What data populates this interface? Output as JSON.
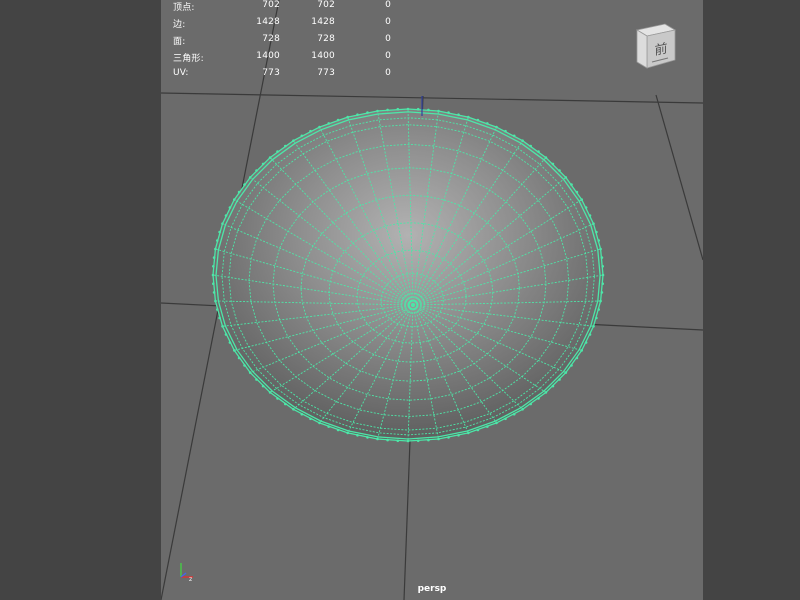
{
  "hud": {
    "rows": [
      {
        "label": "顶点:",
        "v1": "702",
        "v2": "702",
        "v3": "0"
      },
      {
        "label": "边:",
        "v1": "1428",
        "v2": "1428",
        "v3": "0"
      },
      {
        "label": "面:",
        "v1": "728",
        "v2": "728",
        "v3": "0"
      },
      {
        "label": "三角形:",
        "v1": "1400",
        "v2": "1400",
        "v3": "0"
      },
      {
        "label": "UV:",
        "v1": "773",
        "v2": "773",
        "v3": "0"
      }
    ]
  },
  "viewport": {
    "camera_label": "persp"
  },
  "viewcube": {
    "face_label": "前",
    "icon": "view-cube-icon"
  },
  "axis_indicator": {
    "icon": "axis-gizmo-icon"
  },
  "colors": {
    "background": "#6b6b6b",
    "side_panel": "#444444",
    "wireframe": "#4de6a8",
    "grid_line": "#3a3a3a"
  }
}
